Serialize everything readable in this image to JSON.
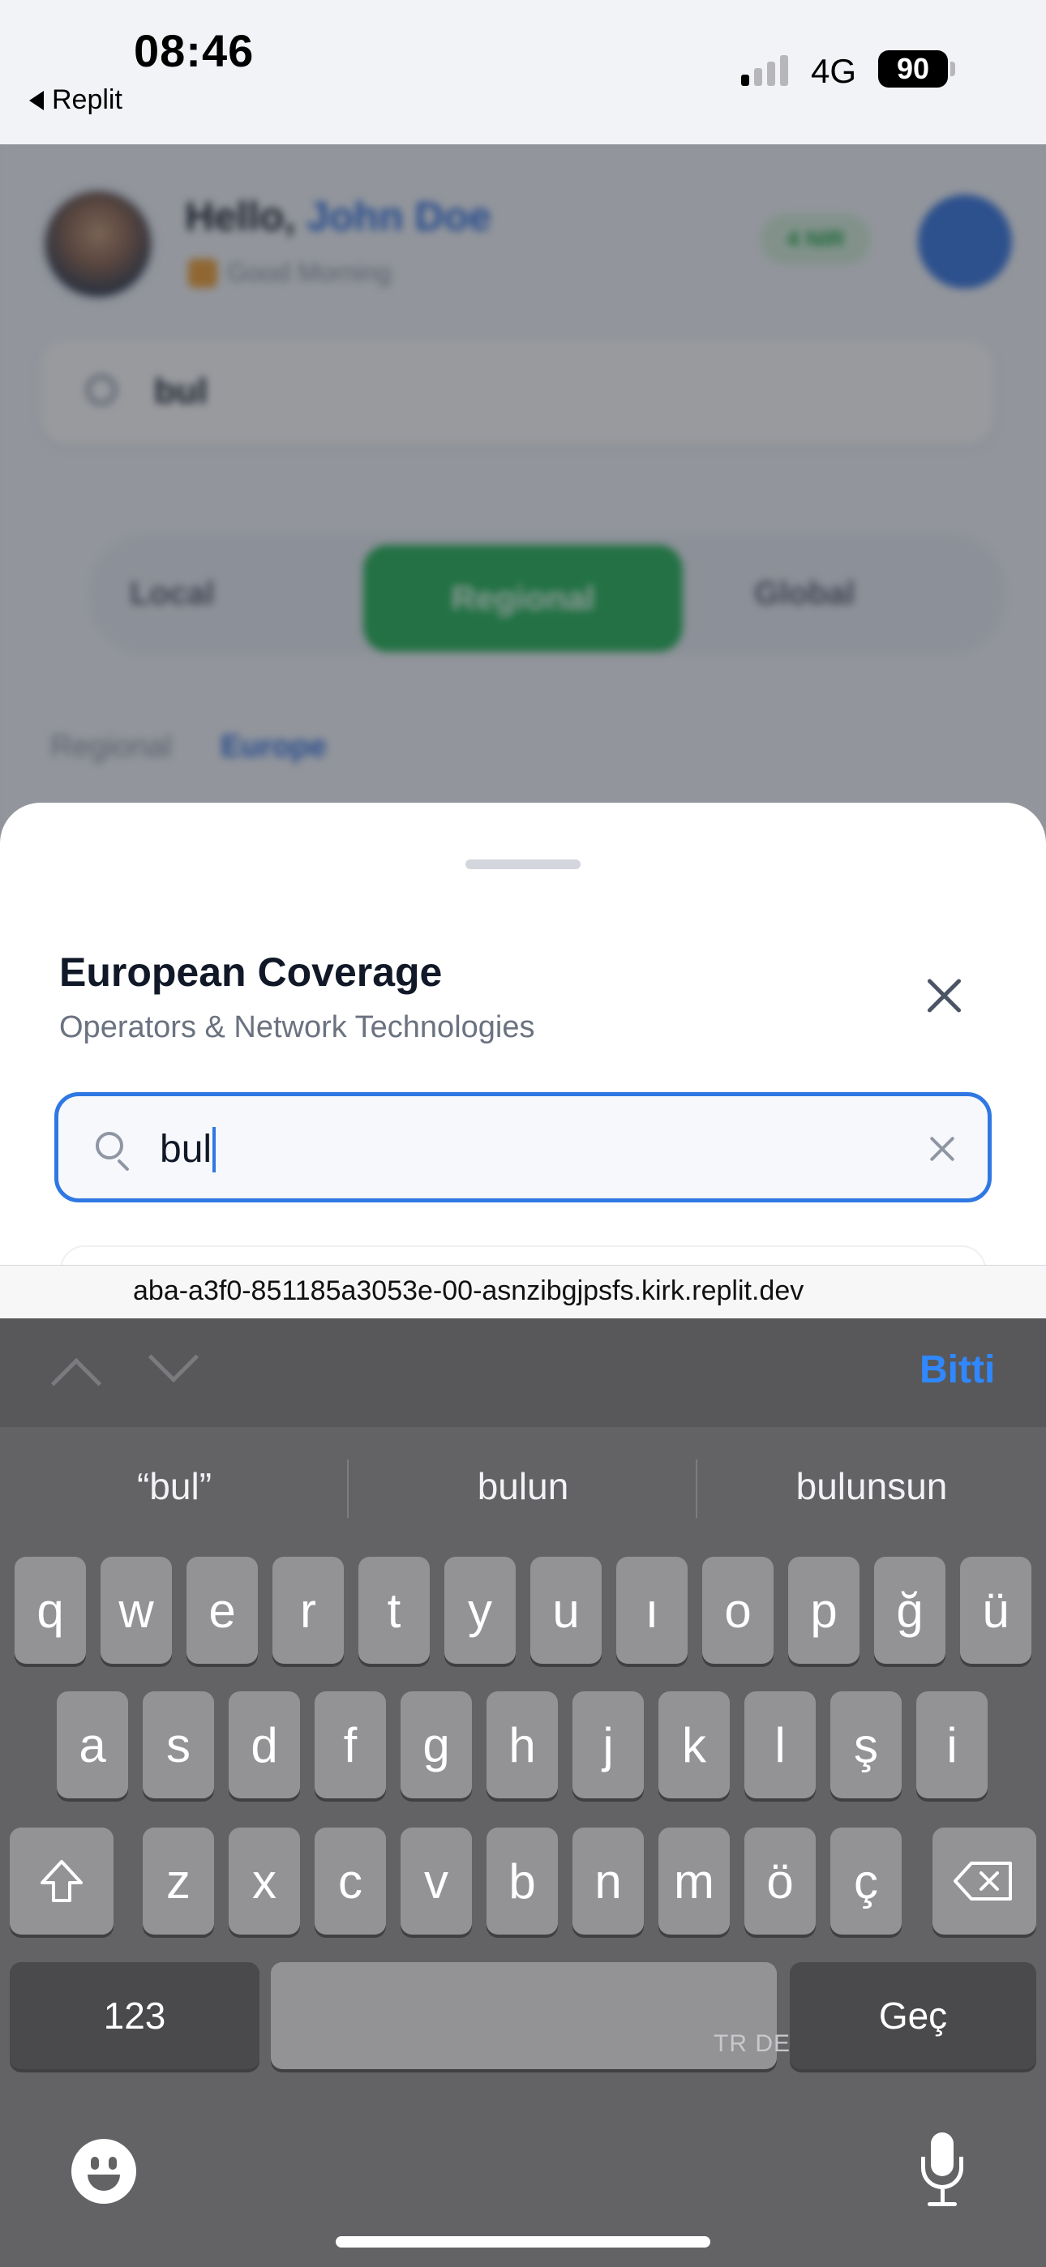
{
  "status": {
    "time": "08:46",
    "back_label": "Replit",
    "network": "4G",
    "battery": "90",
    "signal_bars_on": 1,
    "signal_bars_total": 4
  },
  "background": {
    "greeting_prefix": "Hello,",
    "user_name": "John Doe",
    "subtitle": "Good Morning",
    "badge": "4 NIR",
    "search_value": "bul",
    "segments": [
      "Local",
      "Regional",
      "Global"
    ],
    "active_segment": "Regional",
    "breadcrumb": [
      "Regional",
      "Europe"
    ]
  },
  "sheet": {
    "title": "European Coverage",
    "subtitle": "Operators & Network Technologies",
    "search_value": "bul"
  },
  "url": "aba-a3f0-851185a3053e-00-asnzibgjpsfs.kirk.replit.dev",
  "keyboard": {
    "done_label": "Bitti",
    "suggestions": [
      "“bul”",
      "bulun",
      "bulunsun"
    ],
    "row1": [
      "q",
      "w",
      "e",
      "r",
      "t",
      "y",
      "u",
      "ı",
      "o",
      "p",
      "ğ",
      "ü"
    ],
    "row2": [
      "a",
      "s",
      "d",
      "f",
      "g",
      "h",
      "j",
      "k",
      "l",
      "ş",
      "i"
    ],
    "row3": [
      "z",
      "x",
      "c",
      "v",
      "b",
      "n",
      "m",
      "ö",
      "ç"
    ],
    "numbers_label": "123",
    "return_label": "Geç",
    "space_lang": "TR DE"
  },
  "colors": {
    "accent": "#2f78e3",
    "done": "#2f88ff",
    "regional_active": "#27b45a",
    "keyboard_bg": "#636366"
  }
}
